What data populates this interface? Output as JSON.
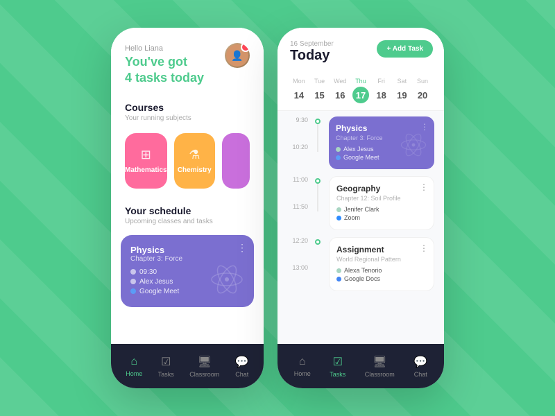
{
  "background": "#4ecb8d",
  "leftPhone": {
    "greeting": "Hello Liana",
    "headline_line1": "You've got",
    "headline_line2": "4 tasks today",
    "courses_title": "Courses",
    "courses_subtitle": "Your running subjects",
    "courses": [
      {
        "id": "math",
        "label": "Mathematics",
        "icon": "⊞"
      },
      {
        "id": "chem",
        "label": "Chemistry",
        "icon": "⚗"
      }
    ],
    "schedule_title": "Your schedule",
    "schedule_subtitle": "Upcoming classes and tasks",
    "physics_card": {
      "title": "Physics",
      "chapter": "Chapter 3: Force",
      "time": "09:30",
      "teacher": "Alex Jesus",
      "platform": "Google Meet"
    },
    "nav": [
      {
        "id": "home",
        "label": "Home",
        "icon": "⌂",
        "active": true
      },
      {
        "id": "tasks",
        "label": "Tasks",
        "icon": "☑",
        "active": false
      },
      {
        "id": "classroom",
        "label": "Classroom",
        "icon": "🖥",
        "active": false
      },
      {
        "id": "chat",
        "label": "Chat",
        "icon": "💬",
        "active": false
      }
    ]
  },
  "rightPhone": {
    "date_small": "16 September",
    "date_big": "Today",
    "add_task_label": "+ Add Task",
    "calendar": [
      {
        "day": "Mon",
        "num": "14",
        "active": false
      },
      {
        "day": "Tue",
        "num": "15",
        "active": false
      },
      {
        "day": "Wed",
        "num": "16",
        "active": false
      },
      {
        "day": "Thu",
        "num": "17",
        "active": true
      },
      {
        "day": "Fri",
        "num": "18",
        "active": false
      },
      {
        "day": "Sat",
        "num": "19",
        "active": false
      },
      {
        "day": "Sun",
        "num": "20",
        "active": false
      }
    ],
    "events": [
      {
        "id": "physics",
        "time_start": "9:30",
        "time_end": "10:20",
        "type": "physics",
        "title": "Physics",
        "chapter": "Chapter 3: Force",
        "teacher": "Alex Jesus",
        "platform": "Google Meet"
      },
      {
        "id": "geography",
        "time_start": "11:00",
        "time_end": "11:50",
        "type": "geo",
        "title": "Geography",
        "chapter": "Chapter 12: Soil Profile",
        "teacher": "Jenifer Clark",
        "platform": "Zoom"
      },
      {
        "id": "assignment",
        "time_start": "12:20",
        "time_end": "13:00",
        "type": "assign",
        "title": "Assignment",
        "chapter": "World Regional Pattern",
        "teacher": "Alexa Tenorio",
        "platform": "Google Docs"
      }
    ],
    "nav": [
      {
        "id": "home",
        "label": "Home",
        "icon": "⌂",
        "active": false
      },
      {
        "id": "tasks",
        "label": "Tasks",
        "icon": "☑",
        "active": true
      },
      {
        "id": "classroom",
        "label": "Classroom",
        "icon": "🖥",
        "active": false
      },
      {
        "id": "chat",
        "label": "Chat",
        "icon": "💬",
        "active": false
      }
    ]
  }
}
